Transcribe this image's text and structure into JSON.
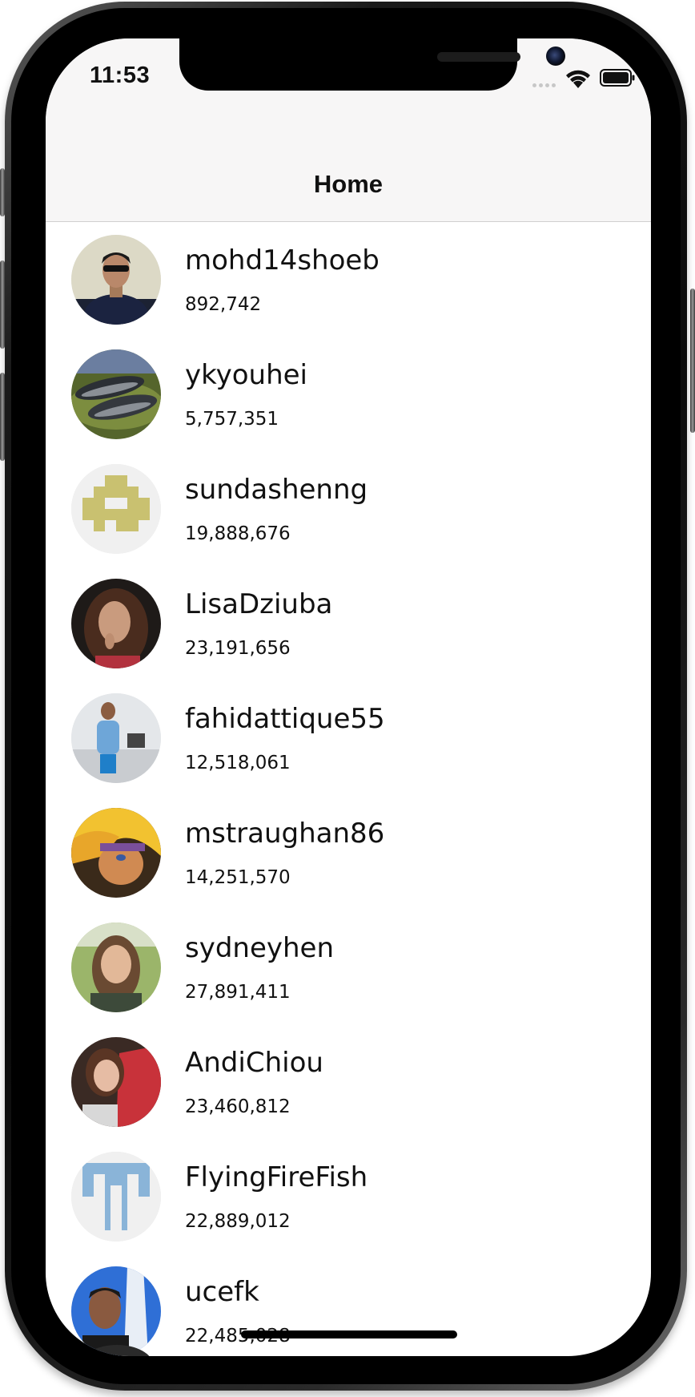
{
  "status_bar": {
    "time": "11:53"
  },
  "nav": {
    "title": "Home"
  },
  "users": [
    {
      "username": "mohd14shoeb",
      "count": "892,742",
      "avatar": "man-sunglasses-photo"
    },
    {
      "username": "ykyouhei",
      "count": "5,757,351",
      "avatar": "fish-photo"
    },
    {
      "username": "sundashenng",
      "count": "19,888,676",
      "avatar": "identicon-olive"
    },
    {
      "username": "LisaDziuba",
      "count": "23,191,656",
      "avatar": "woman-curly-hair-photo"
    },
    {
      "username": "fahidattique55",
      "count": "12,518,061",
      "avatar": "man-office-photo"
    },
    {
      "username": "mstraughan86",
      "count": "14,251,570",
      "avatar": "anime-character-art"
    },
    {
      "username": "sydneyhen",
      "count": "27,891,411",
      "avatar": "woman-outdoor-photo"
    },
    {
      "username": "AndiChiou",
      "count": "23,460,812",
      "avatar": "woman-red-shirt-photo"
    },
    {
      "username": "FlyingFireFish",
      "count": "22,889,012",
      "avatar": "identicon-blue"
    },
    {
      "username": "ucefk",
      "count": "22,485,028",
      "avatar": "man-monument-photo"
    }
  ]
}
